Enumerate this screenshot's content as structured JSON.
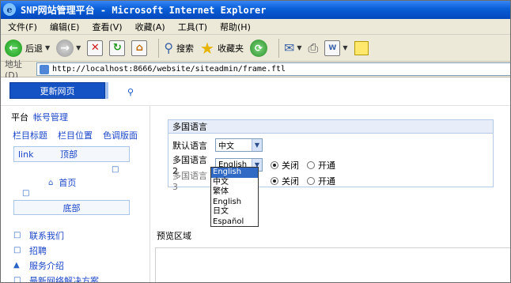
{
  "window": {
    "title": "SNP网站管理平台 - Microsoft Internet Explorer",
    "icon": "ie-icon"
  },
  "menubar": {
    "items": [
      "文件(F)",
      "编辑(E)",
      "查看(V)",
      "收藏(A)",
      "工具(T)",
      "帮助(H)"
    ]
  },
  "toolbar": {
    "back_label": "后退",
    "search_label": "搜索",
    "favorites_label": "收藏夹",
    "icons": [
      "back-arrow-icon",
      "forward-arrow-icon",
      "stop-icon",
      "refresh-icon",
      "home-icon",
      "search-icon",
      "favorites-star-icon",
      "history-icon",
      "mail-icon",
      "print-icon",
      "edit-icon",
      "notes-icon"
    ]
  },
  "address": {
    "label": "地址(D)",
    "url": "http://localhost:8666/website/siteadmin/frame.ftl"
  },
  "top": {
    "update_button": "更新网页"
  },
  "left": {
    "platform": "平台",
    "account": "帐号管理",
    "links": [
      "栏目标题",
      "栏目位置",
      "色调版面"
    ],
    "layout_link": "link",
    "layout_top": "顶部",
    "home": "首页",
    "bottom": "底部",
    "nav": [
      "联系我们",
      "招聘",
      "服务介绍",
      "最新网络解决方案"
    ]
  },
  "panel": {
    "title": "多国语言",
    "default_label": "默认语言",
    "default_value": "中文",
    "lang2_label": "多国语言2",
    "lang2_value": "English",
    "lang3_label": "多国语言3",
    "off_label": "关闭",
    "on_label": "开通",
    "lang2_state": "关闭",
    "lang3_state": "关闭"
  },
  "dropdown": {
    "options": [
      "English",
      "中文",
      "繁体",
      "English",
      "日文",
      "Español"
    ],
    "highlighted_index": 0
  },
  "preview": {
    "title": "预览区域"
  },
  "colors": {
    "title_bar": "#0a5fd8",
    "button": "#1553c5",
    "link": "#1a46c8",
    "selection": "#316ac5",
    "panel_header": "#e8eef9"
  }
}
